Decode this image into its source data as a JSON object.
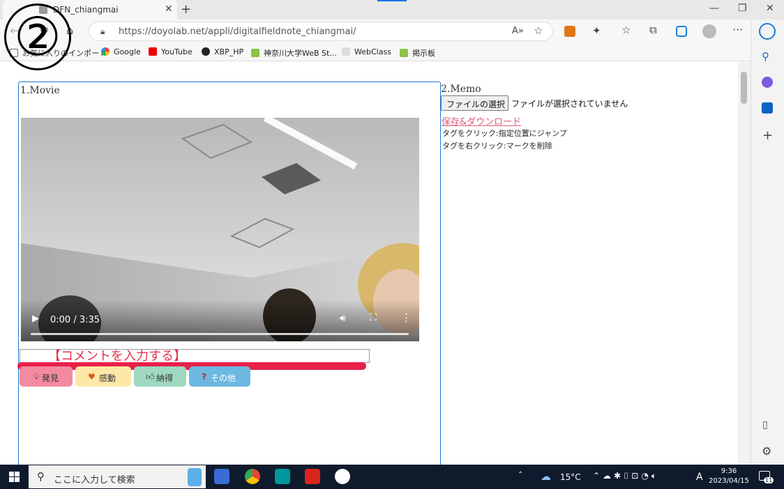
{
  "browser": {
    "tab_title": "DFN_chiangmai",
    "url_host": "https://doyolab.net",
    "url_path": "/appli/digitalfieldnote_chiangmai/",
    "bookmarks": [
      {
        "label": "お気に入りのインポート",
        "icon": "folder-icon"
      },
      {
        "label": "Google",
        "icon": "google-icon"
      },
      {
        "label": "YouTube",
        "icon": "youtube-icon"
      },
      {
        "label": "XBP_HP",
        "icon": "github-icon"
      },
      {
        "label": "神奈川大学WeB St...",
        "icon": "leaf-icon"
      },
      {
        "label": "WebClass",
        "icon": "webclass-icon"
      },
      {
        "label": "掲示板",
        "icon": "leaf-icon"
      }
    ]
  },
  "movie": {
    "title": "1.Movie",
    "time": "0:00 / 3:35"
  },
  "comment": {
    "overlay": "【コメントを入力する】",
    "accent": "#e8204a"
  },
  "tags": [
    {
      "label": "発見",
      "icon": "lightbulb-icon",
      "color": "#f48aa0"
    },
    {
      "label": "感動",
      "icon": "heart-icon",
      "color": "#fde8a8"
    },
    {
      "label": "納得",
      "icon": "thumbsup-icon",
      "color": "#9ed8c0"
    },
    {
      "label": "その他",
      "icon": "question-icon",
      "color": "#6cb8e0"
    }
  ],
  "memo": {
    "title": "2.Memo",
    "file_button": "ファイルの選択",
    "file_status": "ファイルが選択されていません",
    "save_link": "保存&ダウンロード",
    "hint1": "タグをクリック:指定位置にジャンプ",
    "hint2": "タグを右クリック:マークを削除"
  },
  "taskbar": {
    "search_placeholder": "ここに入力して検索",
    "weather": "15°C",
    "ime": "A",
    "time": "9:36",
    "date": "2023/04/15",
    "notification_count": "11"
  },
  "annotation": {
    "step_number": "②"
  }
}
